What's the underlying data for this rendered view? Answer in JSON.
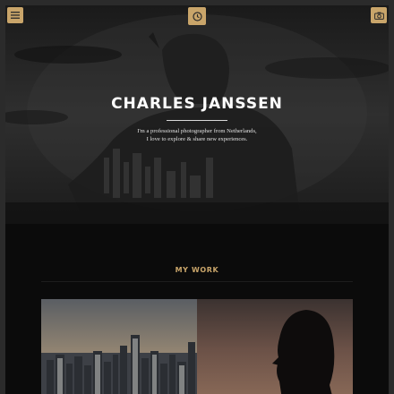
{
  "header": {
    "menu_icon": "menu-icon",
    "center_icon": "clock-icon",
    "right_icon": "camera-icon"
  },
  "hero": {
    "name": "CHARLES JANSSEN",
    "bio_line1": "I'm a professional photographer from Netherlands,",
    "bio_line2": "I love to explore & share new experiences."
  },
  "work": {
    "title": "MY WORK"
  },
  "colors": {
    "accent": "#c9a56a",
    "background": "#0b0b0b"
  }
}
